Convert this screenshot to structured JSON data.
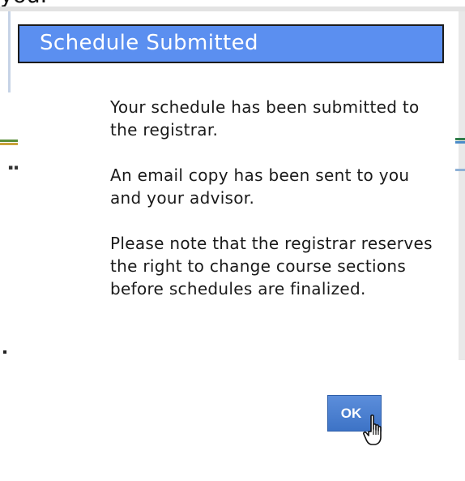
{
  "background": {
    "clipped_heading": "you."
  },
  "dialog": {
    "title": "Schedule Submitted",
    "messages": [
      "Your schedule has been submitted to the registrar.",
      "An email copy has been sent to you and your advisor.",
      "Please note that the registrar reserves the right to change course sections before schedules are finalized."
    ],
    "ok_label": "OK"
  },
  "colors": {
    "titlebar": "#5b8ff0",
    "title_text": "#ffffff",
    "ok_button": "#4a7fd0"
  },
  "icons": [
    "calendar-icon",
    "hand-cursor-icon"
  ]
}
